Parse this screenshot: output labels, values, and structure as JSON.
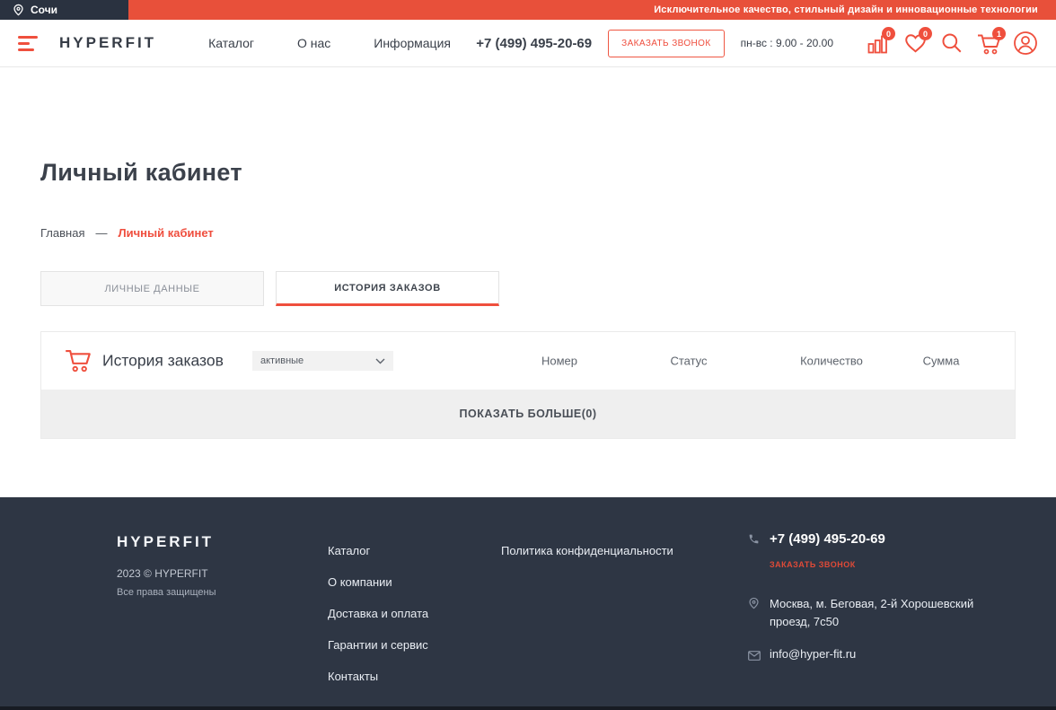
{
  "topbar": {
    "city": "Сочи",
    "promo": "Исключительное качество, стильный дизайн и инновационные технологии"
  },
  "header": {
    "logo": "HYPERFIT",
    "nav": [
      {
        "label": "Каталог"
      },
      {
        "label": "О нас"
      },
      {
        "label": "Информация"
      }
    ],
    "phone": "+7 (499) 495-20-69",
    "callback_button": "ЗАКАЗАТЬ ЗВОНОК",
    "hours": "пн-вс : 9.00 - 20.00",
    "icons": {
      "compare_badge": "0",
      "favorites_badge": "0",
      "cart_badge": "1"
    }
  },
  "page": {
    "title": "Личный кабинет",
    "breadcrumb": {
      "home": "Главная",
      "separator": "—",
      "current": "Личный кабинет"
    },
    "tabs": [
      {
        "label": "ЛИЧНЫЕ ДАННЫЕ",
        "active": false
      },
      {
        "label": "ИСТОРИЯ ЗАКАЗОВ",
        "active": true
      }
    ],
    "orders": {
      "title": "История заказов",
      "filter_value": "активные",
      "columns": [
        {
          "label": "Номер"
        },
        {
          "label": "Статус"
        },
        {
          "label": "Количество"
        },
        {
          "label": "Сумма"
        }
      ],
      "rows": [],
      "show_more": "ПОКАЗАТЬ БОЛЬШЕ(0)"
    }
  },
  "footer": {
    "logo": "HYPERFIT",
    "copyright": "2023 © HYPERFIT",
    "rights": "Все права защищены",
    "links": [
      {
        "label": "Каталог"
      },
      {
        "label": "О компании"
      },
      {
        "label": "Доставка и оплата"
      },
      {
        "label": "Гарантии и сервис"
      },
      {
        "label": "Контакты"
      }
    ],
    "policy": "Политика конфиденциальности",
    "contacts": {
      "phone": "+7 (499) 495-20-69",
      "callback": "ЗАКАЗАТЬ ЗВОНОК",
      "address": "Москва, м. Беговая, 2-й Хорошевский проезд, 7с50",
      "email": "info@hyper-fit.ru"
    }
  },
  "colors": {
    "accent": "#ef4f3d",
    "promo_bg": "#e8503a",
    "topbar_bg": "#2a3240",
    "footer_bg": "#2e3644"
  }
}
